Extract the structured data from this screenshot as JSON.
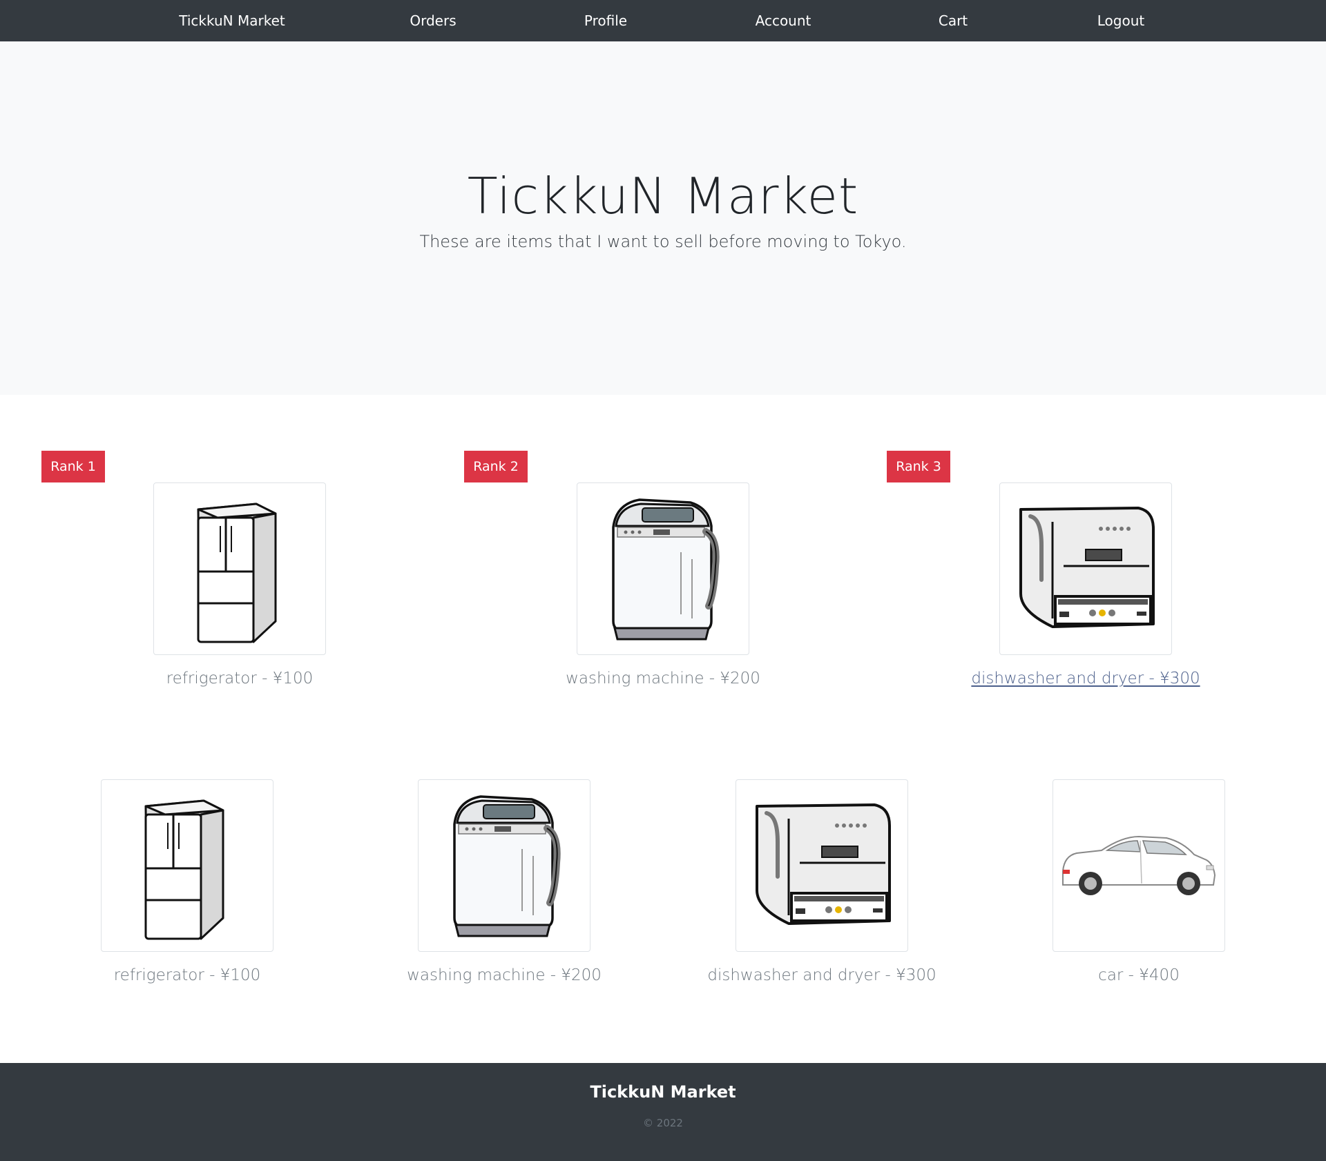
{
  "nav": {
    "brand": "TickkuN Market",
    "orders": "Orders",
    "profile": "Profile",
    "account": "Account",
    "cart": "Cart",
    "logout": "Logout"
  },
  "hero": {
    "title": "TickkuN Market",
    "subtitle": "These are items that I want to sell before moving to Tokyo."
  },
  "ranking": [
    {
      "badge": "Rank 1",
      "caption": "refrigerator - ¥100",
      "icon": "refrigerator-image"
    },
    {
      "badge": "Rank 2",
      "caption": "washing machine - ¥200",
      "icon": "washing-machine-image"
    },
    {
      "badge": "Rank 3",
      "caption": "dishwasher and dryer - ¥300",
      "icon": "dishwasher-image"
    }
  ],
  "items": [
    {
      "caption": "refrigerator - ¥100",
      "icon": "refrigerator-image"
    },
    {
      "caption": "washing machine - ¥200",
      "icon": "washing-machine-image"
    },
    {
      "caption": "dishwasher and dryer - ¥300",
      "icon": "dishwasher-image"
    },
    {
      "caption": "car - ¥400",
      "icon": "car-image"
    }
  ],
  "footer": {
    "title": "TickkuN Market",
    "copyright": "© 2022"
  },
  "colors": {
    "navbar": "#343a40",
    "hero_bg": "#f8f9fa",
    "badge": "#dc3545",
    "caption": "#6c757d",
    "link_active": "#4a5e8a"
  }
}
